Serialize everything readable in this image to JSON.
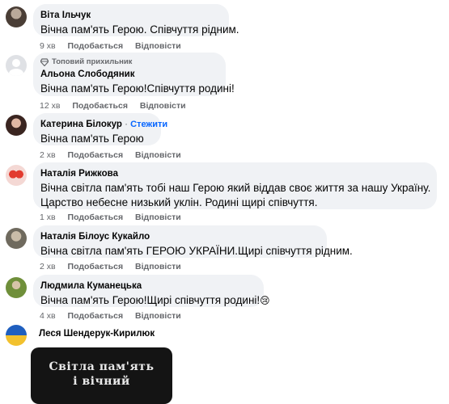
{
  "comments": [
    {
      "author": "Віта Ільчук",
      "text": "Вічна пам'ять Герою. Співчуття рідним.",
      "time": "9 хв",
      "like_label": "Подобається",
      "reply_label": "Відповісти"
    },
    {
      "badge": "Топовий прихильник",
      "author": "Альона Слободяник",
      "text": "Вічна пам'ять Герою!Співчуття родині!",
      "time": "12 хв",
      "like_label": "Подобається",
      "reply_label": "Відповісти"
    },
    {
      "author": "Катерина Білокур",
      "follow_label": "Стежити",
      "text": "Вічна пам'ять Герою",
      "time": "2 хв",
      "like_label": "Подобається",
      "reply_label": "Відповісти"
    },
    {
      "author": "Наталія Рижкова",
      "text_line1": "Вічна світла пам'ять тобі наш Герою який віддав своє життя за нашу Україну.",
      "text_line2": "Царство небесне низький уклін. Родині щирі співчуття.",
      "time": "1 хв",
      "like_label": "Подобається",
      "reply_label": "Відповісти"
    },
    {
      "author": "Наталія Білоус Кукайло",
      "text": "Вічна світла пам'ять ГЕРОЮ УКРАЇНИ.Щирі співчуття рідним.",
      "time": "2 хв",
      "like_label": "Подобається",
      "reply_label": "Відповісти"
    },
    {
      "author": "Людмила Куманецька",
      "text": "Вічна пам'ять Герою!Щирі співчуття родині!",
      "emoji": "😢",
      "time": "4 хв",
      "like_label": "Подобається",
      "reply_label": "Відповісти"
    },
    {
      "author": "Леся Шендерук-Кирилюк",
      "media_line1": "Світла пам'ять",
      "media_line2": "і вічний"
    }
  ],
  "colors": {
    "bubble": "#f0f2f5",
    "meta": "#65676b",
    "link": "#0866ff"
  },
  "icons": {
    "badge": "diamond-badge-icon"
  }
}
